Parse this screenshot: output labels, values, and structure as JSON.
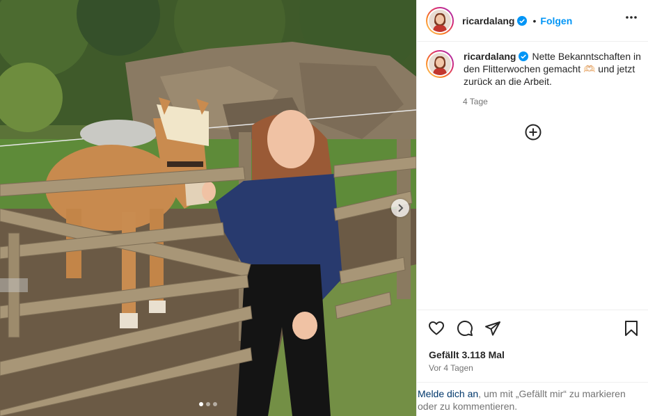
{
  "post": {
    "username": "ricardalang",
    "verified": true,
    "follow_label": "Folgen",
    "separator": "•",
    "caption_username": "ricardalang",
    "caption_text": "Nette Bekanntschaften in den Flitterwochen gemacht 🫶🏻 und jetzt zurück an die Arbeit.",
    "caption_time": "4 Tage",
    "likes_text": "Gefällt 3.118 Mal",
    "date_text": "Vor 4 Tagen"
  },
  "login_prompt": {
    "link_text": "Melde dich an",
    "rest_text": ", um mit „Gefällt mir“ zu markieren oder zu kommentieren."
  },
  "carousel": {
    "slide_count": 3,
    "active_index": 0
  },
  "icons": {
    "verified": "verified-badge-icon",
    "more": "more-options-icon",
    "add_comment": "plus-circle-icon",
    "like": "heart-icon",
    "comment": "comment-icon",
    "share": "paper-plane-icon",
    "save": "bookmark-icon",
    "next": "chevron-right-icon"
  },
  "colors": {
    "accent": "#0095f6",
    "verified": "#0095f6",
    "link": "#00376b",
    "muted": "#737373",
    "border": "#efefef"
  }
}
